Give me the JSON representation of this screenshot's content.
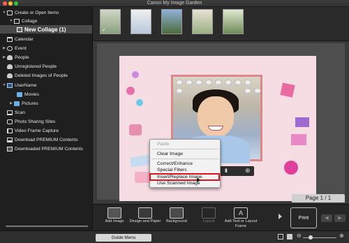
{
  "window": {
    "title": "Canon My Image Garden",
    "colors": {
      "close": "#ff5f57",
      "minimize": "#ffbd2e",
      "zoom": "#28c840"
    }
  },
  "sidebar": {
    "items": [
      {
        "label": "Create or Open Items",
        "icon": "create-items-icon",
        "expanded": true
      },
      {
        "label": "Collage",
        "icon": "collage-icon",
        "expanded": true
      },
      {
        "label": "New Collage (1)",
        "icon": "collage-file-icon",
        "selected": true
      },
      {
        "label": "Calendar",
        "icon": "calendar-icon"
      },
      {
        "label": "Event",
        "icon": "event-icon",
        "expanded": false
      },
      {
        "label": "People",
        "icon": "people-icon",
        "expanded": false
      },
      {
        "label": "Unregistered People",
        "icon": "unregistered-people-icon"
      },
      {
        "label": "Deleted Images of People",
        "icon": "deleted-people-icon"
      },
      {
        "label": "UserName",
        "icon": "computer-icon",
        "expanded": true
      },
      {
        "label": "Movies",
        "icon": "folder-icon"
      },
      {
        "label": "Pictures",
        "icon": "folder-icon",
        "expanded": false
      },
      {
        "label": "Scan",
        "icon": "scan-icon"
      },
      {
        "label": "Photo Sharing Sites",
        "icon": "photo-sharing-icon"
      },
      {
        "label": "Video Frame Capture",
        "icon": "video-frame-icon"
      },
      {
        "label": "Download PREMIUM Contents",
        "icon": "download-icon"
      },
      {
        "label": "Downloaded PREMIUM Contents",
        "icon": "downloaded-icon"
      }
    ]
  },
  "thumbnails": {
    "items": [
      {
        "checked": true
      },
      {
        "checked": false
      },
      {
        "checked": false
      },
      {
        "checked": false
      },
      {
        "checked": false
      }
    ]
  },
  "canvas": {
    "photo_border_color": "#dd8888",
    "page_color": "#f5dde3"
  },
  "context_menu": {
    "items": [
      {
        "label": "Paste",
        "enabled": false
      },
      {
        "label": "Clear Image",
        "enabled": true
      },
      {
        "label": "Correct/Enhance",
        "enabled": true
      },
      {
        "label": "Special Filters",
        "enabled": true
      },
      {
        "label": "Insert/Replace Image",
        "enabled": true,
        "highlighted": true
      },
      {
        "label": "Use Scanned Image",
        "enabled": true
      }
    ],
    "highlight_color": "#e0121e"
  },
  "page_indicator": "Page 1 / 1",
  "toolbar": {
    "buttons": [
      {
        "label": "Add Image",
        "icon": "add-image-icon",
        "enabled": true
      },
      {
        "label": "Design and Paper",
        "icon": "design-paper-icon",
        "enabled": true
      },
      {
        "label": "Background",
        "icon": "background-icon",
        "enabled": true
      },
      {
        "label": "Layout",
        "icon": "layout-icon",
        "enabled": false
      },
      {
        "label": "Add Text or Layout Frame",
        "icon": "add-text-icon",
        "enabled": true
      }
    ],
    "print_label": "Print"
  },
  "statusbar": {
    "guide_label": "Guide Menu"
  }
}
